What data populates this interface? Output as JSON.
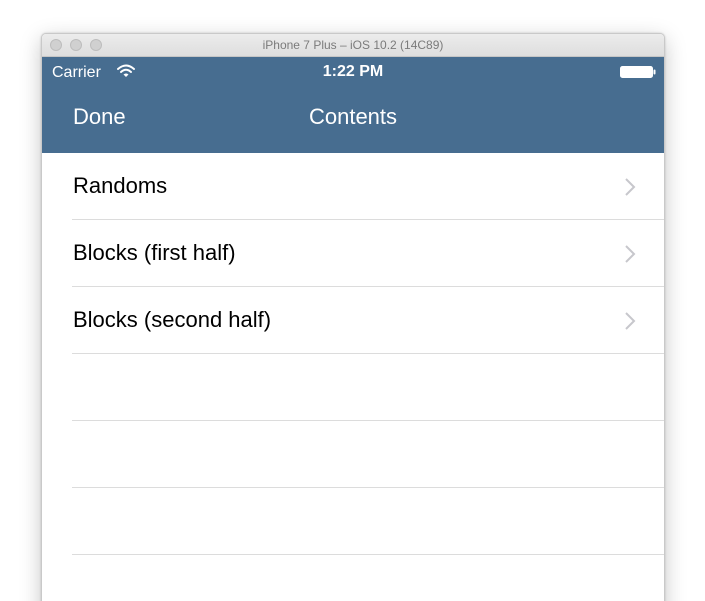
{
  "window": {
    "title": "iPhone 7 Plus – iOS 10.2 (14C89)"
  },
  "status_bar": {
    "carrier": "Carrier",
    "time": "1:22 PM"
  },
  "nav_bar": {
    "done_label": "Done",
    "title": "Contents",
    "background_color": "#476d90"
  },
  "list": {
    "items": [
      {
        "label": "Randoms"
      },
      {
        "label": "Blocks (first half)"
      },
      {
        "label": "Blocks (second half)"
      }
    ]
  }
}
